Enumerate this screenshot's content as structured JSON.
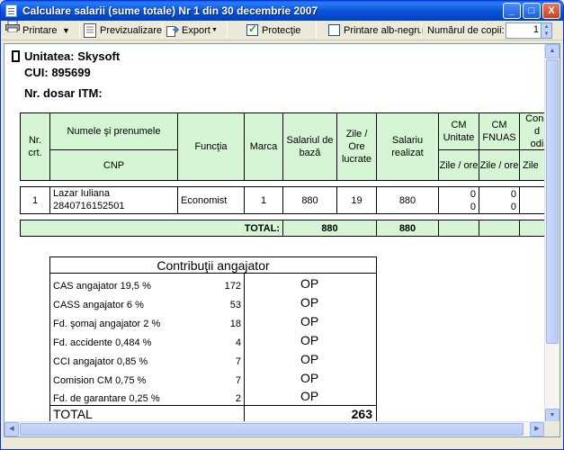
{
  "window": {
    "title": "Calculare salarii (sume totale) Nr 1 din 30 decembrie 2007",
    "minimize": "_",
    "maximize": "□",
    "close": "X"
  },
  "toolbar": {
    "print_label": "Printare",
    "preview_label": "Previzualizare",
    "export_label": "Export",
    "protection_label": "Protecţie",
    "protection_checked": true,
    "bw_label": "Printare alb-negru",
    "bw_checked": false,
    "copies_label": "Numărul de copii:",
    "copies_value": "1"
  },
  "report": {
    "unit_line": "Unitatea: Skysoft",
    "cui_line": "CUI: 895699",
    "itm_line": "Nr. dosar ITM:",
    "headers": {
      "nr": "Nr. crt.",
      "name": "Numele şi prenumele",
      "cnp": "CNP",
      "func": "Funcţia",
      "marca": "Marca",
      "base": "Salariul de bază",
      "days": "Zile / Ore lucrate",
      "realized": "Salariu realizat",
      "cm_unit": "CM Unitate",
      "cm_fnuas": "CM FNUAS",
      "cm_unit_sub": "Zile / ore",
      "cm_fnuas_sub": "Zile / ore",
      "cone": "Conc\nd\nodi",
      "zile_cut": "Zile"
    },
    "rows": [
      {
        "nr": "1",
        "name": "Lazar Iuliana",
        "cnp": "2840716152501",
        "func": "Economist",
        "marca": "1",
        "base": "880",
        "days": "19",
        "realized": "880",
        "cm_unit_a": "0",
        "cm_unit_b": "0",
        "cm_fnuas_a": "0",
        "cm_fnuas_b": "0"
      }
    ],
    "total_label": "TOTAL:",
    "total_base": "880",
    "total_realized": "880"
  },
  "contributions": {
    "title": "Contribuţii angajator",
    "items": [
      {
        "label": "CAS angajator 19,5 %",
        "value": "172",
        "op": "OP"
      },
      {
        "label": "CASS angajator 6 %",
        "value": "53",
        "op": "OP"
      },
      {
        "label": "Fd. şomaj angajator 2 %",
        "value": "18",
        "op": "OP"
      },
      {
        "label": "Fd. accidente 0,484 %",
        "value": "4",
        "op": "OP"
      },
      {
        "label": "CCI angajator 0,85 %",
        "value": "7",
        "op": "OP"
      },
      {
        "label": "Comision CM 0,75 %",
        "value": "7",
        "op": "OP"
      },
      {
        "label": "Fd. de garantare 0,25 %",
        "value": "2",
        "op": "OP"
      }
    ],
    "total_label": "TOTAL",
    "total_value": "263"
  }
}
